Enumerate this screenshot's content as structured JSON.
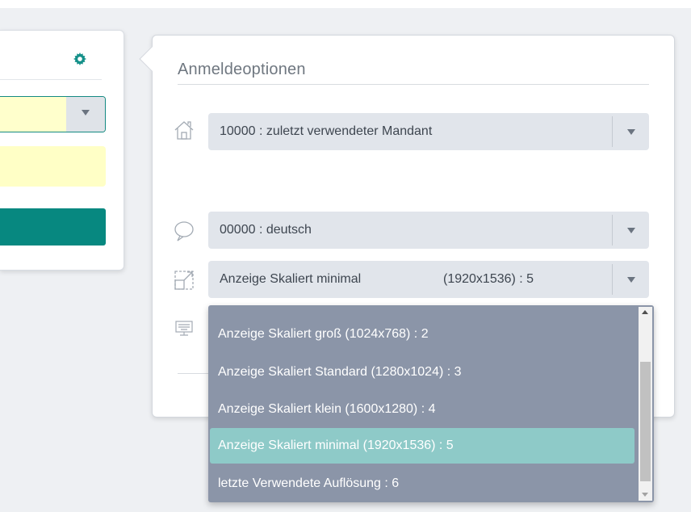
{
  "options": {
    "title": "Anmeldeoptionen",
    "mandant": {
      "icon": "home-icon",
      "value": "10000 : zuletzt verwendeter Mandant"
    },
    "language": {
      "icon": "speech-bubble-icon",
      "value": "00000 : deutsch"
    },
    "resolution": {
      "icon": "resize-icon",
      "value_name": "Anzeige Skaliert minimal",
      "value_size": "(1920x1536) : 5"
    },
    "terminal": {
      "icon": "keyboard-monitor-icon"
    }
  },
  "dropdown": {
    "items": [
      "Anzeige Skaliert groß (1024x768) : 2",
      "Anzeige Skaliert Standard (1280x1024) : 3",
      "Anzeige Skaliert klein (1600x1280) : 4",
      "Anzeige Skaliert minimal (1920x1536) : 5",
      "letzte Verwendete Auflösung : 6"
    ],
    "selected_index": 3
  },
  "left_panel": {
    "icon": "gear-icon"
  },
  "colors": {
    "accent": "#078880",
    "dropdown_bg": "#8b95a8",
    "selected": "#8ecac8",
    "yellow_field": "#ffffcc"
  }
}
